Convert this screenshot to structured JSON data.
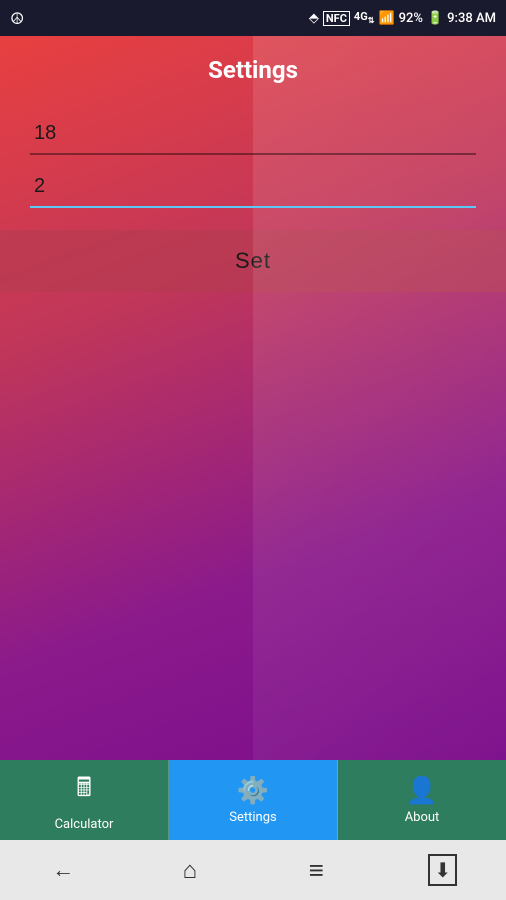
{
  "statusBar": {
    "battery": "92%",
    "time": "9:38 AM",
    "bluetoothIcon": "bluetooth",
    "nfcIcon": "NFC",
    "signalIcon": "signal",
    "dataIcon": "4G"
  },
  "header": {
    "title": "Settings"
  },
  "form": {
    "field1Value": "18",
    "field1Placeholder": "",
    "field2Value": "2",
    "field2Placeholder": "",
    "setButtonLabel": "Set"
  },
  "tabs": [
    {
      "id": "calculator",
      "label": "Calculator",
      "icon": "🖩",
      "active": false
    },
    {
      "id": "settings",
      "label": "Settings",
      "icon": "⚙",
      "active": true
    },
    {
      "id": "about",
      "label": "About",
      "icon": "👤",
      "active": false
    }
  ],
  "navBar": {
    "backIcon": "←",
    "homeIcon": "⌂",
    "menuIcon": "≡",
    "downloadIcon": "⬇"
  }
}
